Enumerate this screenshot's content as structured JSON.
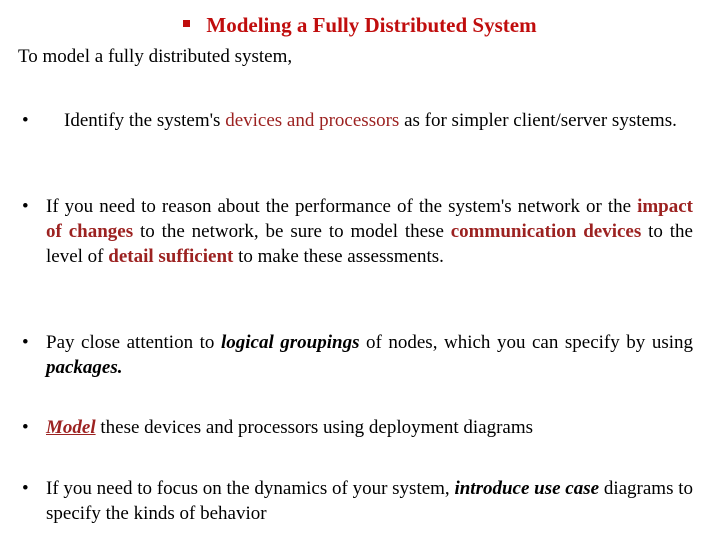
{
  "slide": {
    "title": {
      "bullet_glyph": "square-bullet",
      "text": "Modeling a Fully Distributed System",
      "color": "#C00D0D"
    },
    "lead_in": "To model a fully distributed system,",
    "bullet_marker": "•",
    "colors": {
      "title_red": "#C00D0D",
      "body_red": "#9C2221",
      "text_black": "#000000",
      "background": "#FFFFFF"
    },
    "bullets": [
      {
        "id": "bullet-identify-devices",
        "segments": {
          "s1": "Identify the system's ",
          "s2": "devices and processors",
          "s3": " as for simpler client/server systems."
        }
      },
      {
        "id": "bullet-performance-network",
        "segments": {
          "s1": "If you need to reason about the performance of the system's network or the ",
          "s2": "impact of changes",
          "s3": " to the network, be sure to model these ",
          "s4": "communication devices",
          "s5": " to the level of ",
          "s6": "detail sufficient",
          "s7": " to make these assessments."
        }
      },
      {
        "id": "bullet-logical-groupings",
        "segments": {
          "s1": "Pay close attention to ",
          "s2": "logical groupings",
          "s3": " of nodes, which you can specify by using ",
          "s4": "packages."
        }
      },
      {
        "id": "bullet-model-deployment",
        "segments": {
          "s1": "Model",
          "s2": " these devices and processors using deployment diagrams"
        }
      },
      {
        "id": "bullet-dynamics-use-case",
        "segments": {
          "s1": "If you need to focus on the dynamics of your system, ",
          "s2": "introduce use case",
          "s3": " diagrams to specify the kinds of behavior"
        }
      }
    ]
  }
}
